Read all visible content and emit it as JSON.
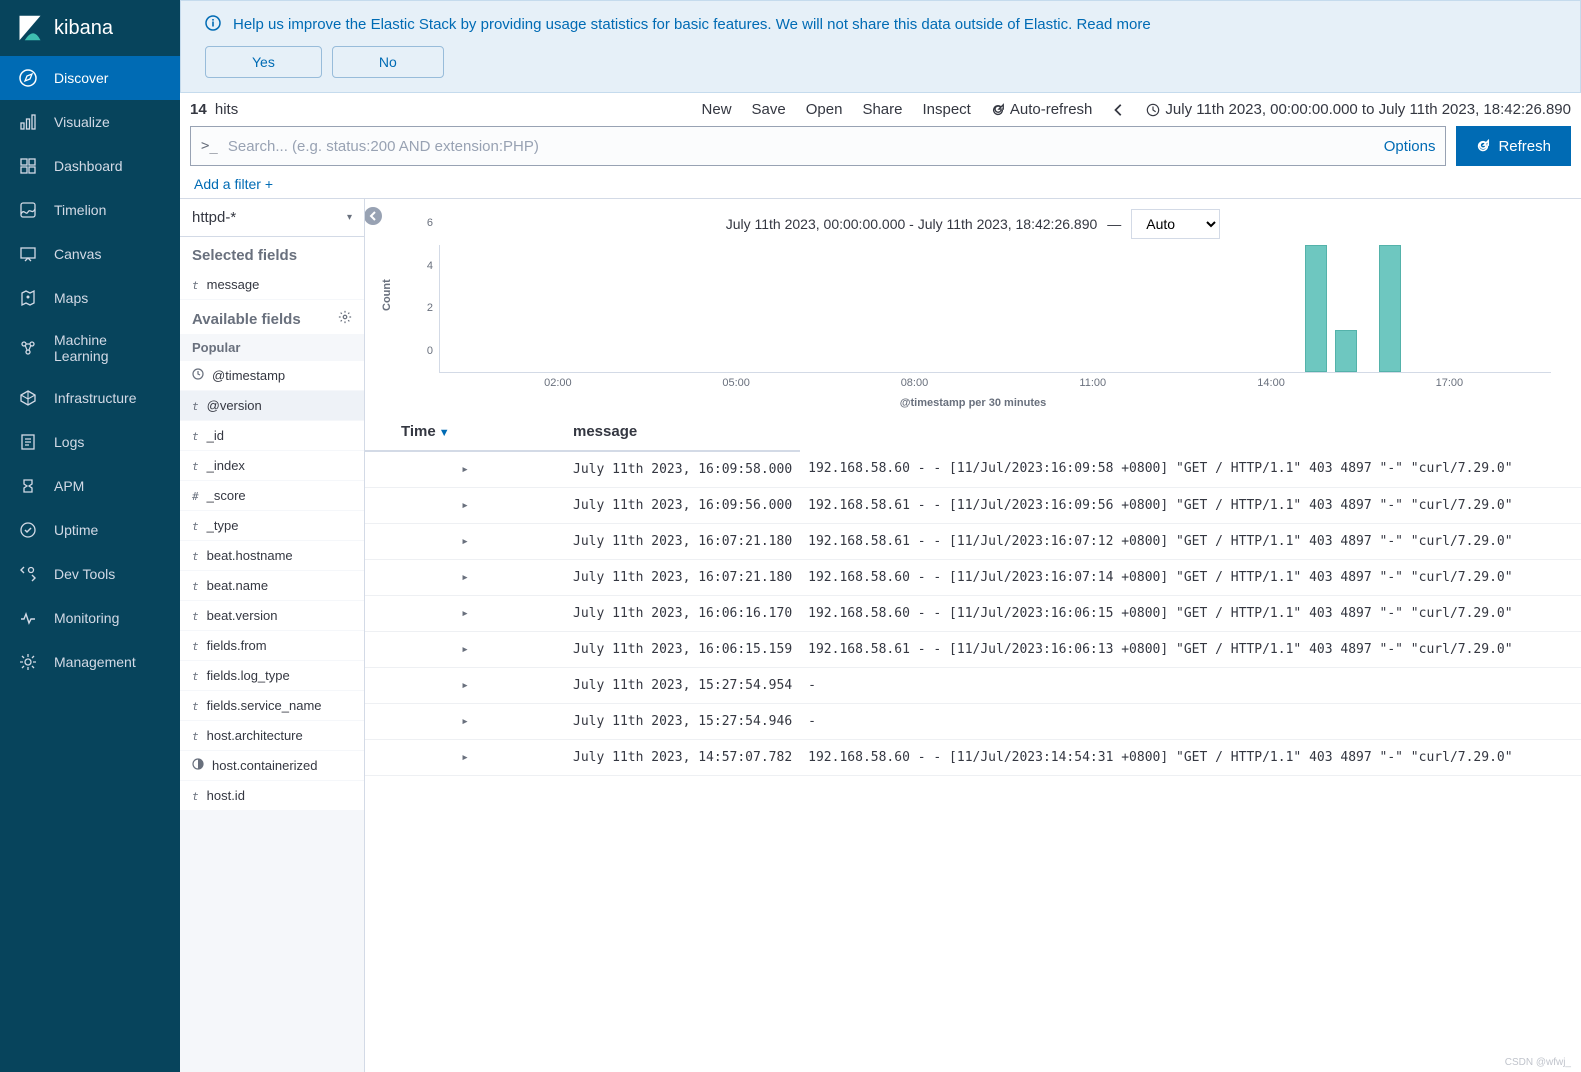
{
  "brand": "kibana",
  "nav": [
    {
      "key": "discover",
      "label": "Discover"
    },
    {
      "key": "visualize",
      "label": "Visualize"
    },
    {
      "key": "dashboard",
      "label": "Dashboard"
    },
    {
      "key": "timelion",
      "label": "Timelion"
    },
    {
      "key": "canvas",
      "label": "Canvas"
    },
    {
      "key": "maps",
      "label": "Maps"
    },
    {
      "key": "ml",
      "label": "Machine Learning"
    },
    {
      "key": "infra",
      "label": "Infrastructure"
    },
    {
      "key": "logs",
      "label": "Logs"
    },
    {
      "key": "apm",
      "label": "APM"
    },
    {
      "key": "uptime",
      "label": "Uptime"
    },
    {
      "key": "devtools",
      "label": "Dev Tools"
    },
    {
      "key": "monitoring",
      "label": "Monitoring"
    },
    {
      "key": "management",
      "label": "Management"
    }
  ],
  "banner": {
    "text_prefix": "Help us improve the Elastic Stack by providing usage statistics for basic features. We will not share this data outside of Elastic. ",
    "read_more": "Read more",
    "yes": "Yes",
    "no": "No"
  },
  "topbar": {
    "hits_count": "14",
    "hits_label": "hits",
    "new": "New",
    "save": "Save",
    "open": "Open",
    "share": "Share",
    "inspect": "Inspect",
    "autorefresh": "Auto-refresh",
    "time_range": "July 11th 2023, 00:00:00.000 to July 11th 2023, 18:42:26.890"
  },
  "search": {
    "placeholder": "Search... (e.g. status:200 AND extension:PHP)",
    "options": "Options",
    "refresh": "Refresh"
  },
  "filters": {
    "add": "Add a filter",
    "plus": "+"
  },
  "index_pattern": "httpd-*",
  "fields": {
    "selected_title": "Selected fields",
    "available_title": "Available fields",
    "popular_title": "Popular",
    "selected": [
      {
        "type": "t",
        "name": "message"
      }
    ],
    "popular": [
      {
        "type": "clock",
        "name": "@timestamp"
      }
    ],
    "available": [
      {
        "type": "t",
        "name": "@version"
      },
      {
        "type": "t",
        "name": "_id"
      },
      {
        "type": "t",
        "name": "_index"
      },
      {
        "type": "#",
        "name": "_score"
      },
      {
        "type": "t",
        "name": "_type"
      },
      {
        "type": "t",
        "name": "beat.hostname"
      },
      {
        "type": "t",
        "name": "beat.name"
      },
      {
        "type": "t",
        "name": "beat.version"
      },
      {
        "type": "t",
        "name": "fields.from"
      },
      {
        "type": "t",
        "name": "fields.log_type"
      },
      {
        "type": "t",
        "name": "fields.service_name"
      },
      {
        "type": "t",
        "name": "host.architecture"
      },
      {
        "type": "half",
        "name": "host.containerized"
      },
      {
        "type": "t",
        "name": "host.id"
      }
    ]
  },
  "chart_header": {
    "range": "July 11th 2023, 00:00:00.000 - July 11th 2023, 18:42:26.890",
    "dash": "—",
    "interval": "Auto"
  },
  "chart_data": {
    "type": "bar",
    "ylabel": "Count",
    "xlabel": "@timestamp per 30 minutes",
    "ylim": [
      0,
      6
    ],
    "yticks": [
      0,
      2,
      4,
      6
    ],
    "xticks": [
      "02:00",
      "05:00",
      "08:00",
      "11:00",
      "14:00",
      "17:00"
    ],
    "x_domain_hours": [
      0,
      18.71
    ],
    "series": [
      {
        "name": "count",
        "bars": [
          {
            "x_hour": 14.75,
            "value": 6
          },
          {
            "x_hour": 15.25,
            "value": 2
          },
          {
            "x_hour": 16.0,
            "value": 6
          }
        ]
      }
    ]
  },
  "table": {
    "col_time": "Time",
    "col_message": "message",
    "rows": [
      {
        "time": "July 11th 2023, 16:09:58.000",
        "msg": "192.168.58.60 - - [11/Jul/2023:16:09:58 +0800] \"GET / HTTP/1.1\" 403 4897 \"-\" \"curl/7.29.0\""
      },
      {
        "time": "July 11th 2023, 16:09:56.000",
        "msg": "192.168.58.61 - - [11/Jul/2023:16:09:56 +0800] \"GET / HTTP/1.1\" 403 4897 \"-\" \"curl/7.29.0\""
      },
      {
        "time": "July 11th 2023, 16:07:21.180",
        "msg": "192.168.58.61 - - [11/Jul/2023:16:07:12 +0800] \"GET / HTTP/1.1\" 403 4897 \"-\" \"curl/7.29.0\""
      },
      {
        "time": "July 11th 2023, 16:07:21.180",
        "msg": "192.168.58.60 - - [11/Jul/2023:16:07:14 +0800] \"GET / HTTP/1.1\" 403 4897 \"-\" \"curl/7.29.0\""
      },
      {
        "time": "July 11th 2023, 16:06:16.170",
        "msg": "192.168.58.60 - - [11/Jul/2023:16:06:15 +0800] \"GET / HTTP/1.1\" 403 4897 \"-\" \"curl/7.29.0\""
      },
      {
        "time": "July 11th 2023, 16:06:15.159",
        "msg": "192.168.58.61 - - [11/Jul/2023:16:06:13 +0800] \"GET / HTTP/1.1\" 403 4897 \"-\" \"curl/7.29.0\""
      },
      {
        "time": "July 11th 2023, 15:27:54.954",
        "msg": "-"
      },
      {
        "time": "July 11th 2023, 15:27:54.946",
        "msg": "-"
      },
      {
        "time": "July 11th 2023, 14:57:07.782",
        "msg": "192.168.58.60 - - [11/Jul/2023:14:54:31 +0800] \"GET / HTTP/1.1\" 403 4897 \"-\" \"curl/7.29.0\""
      }
    ]
  },
  "watermark": "CSDN @wfwj_"
}
